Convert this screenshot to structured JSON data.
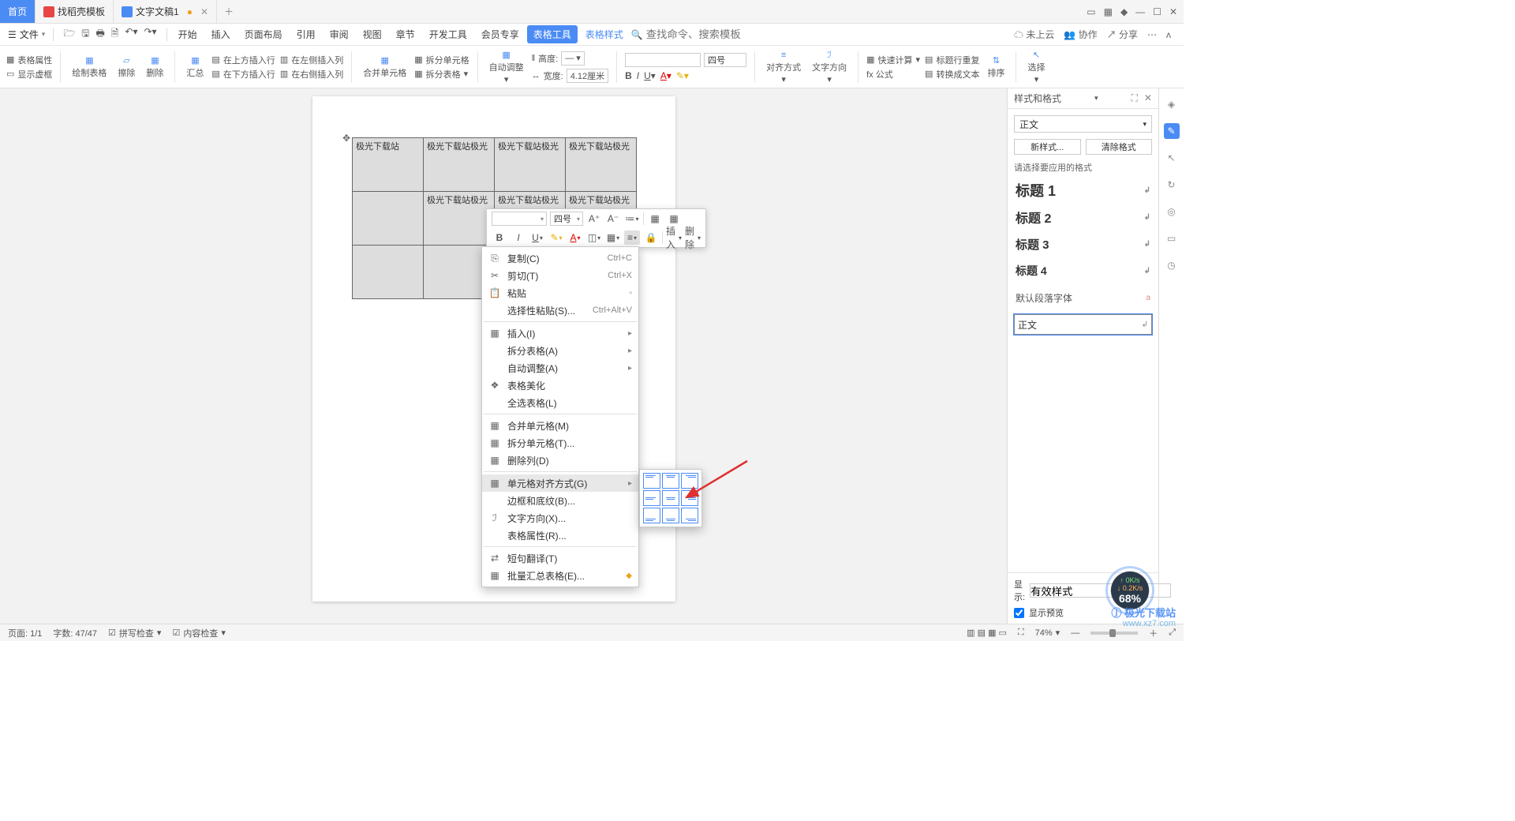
{
  "titlebar": {
    "tabs": [
      {
        "label": "首页",
        "type": "home"
      },
      {
        "label": "找稻壳模板"
      },
      {
        "label": "文字文稿1",
        "modified": true
      }
    ],
    "window_icons": [
      "▭",
      "▦",
      "◆",
      "—",
      "☐",
      "✕"
    ]
  },
  "menubar": {
    "file": "文件",
    "items": [
      "开始",
      "插入",
      "页面布局",
      "引用",
      "审阅",
      "视图",
      "章节",
      "开发工具",
      "会员专享",
      "表格工具",
      "表格样式"
    ],
    "active": "表格工具",
    "search_placeholder": "查找命令、搜索模板",
    "right": {
      "cloud": "未上云",
      "coop": "协作",
      "share": "分享"
    }
  },
  "ribbon": {
    "table_prop": "表格属性",
    "show_frame": "显示虚框",
    "draw": "绘制表格",
    "erase": "擦除",
    "delete": "删除",
    "insert_above": "在上方插入行",
    "insert_below": "在下方插入行",
    "insert_left": "在左侧插入列",
    "insert_right": "在右侧插入列",
    "sum": "汇总",
    "merge": "合并单元格",
    "split_cell": "拆分单元格",
    "split_table": "拆分表格",
    "auto_fit": "自动调整",
    "height": "高度:",
    "width": "宽度:",
    "width_val": "4.12厘米",
    "font_size": "四号",
    "align": "对齐方式",
    "text_dir": "文字方向",
    "formula": "fx 公式",
    "quick_calc": "快速计算",
    "header_repeat": "标题行重复",
    "convert": "转换成文本",
    "sort": "排序",
    "select": "选择"
  },
  "mini": {
    "font": "",
    "size": "四号",
    "ins": "插入",
    "del": "删除"
  },
  "ctx": {
    "copy": "复制(C)",
    "copy_k": "Ctrl+C",
    "cut": "剪切(T)",
    "cut_k": "Ctrl+X",
    "paste": "粘贴",
    "paste_special": "选择性粘贴(S)...",
    "paste_special_k": "Ctrl+Alt+V",
    "insert": "插入(I)",
    "split_table": "拆分表格(A)",
    "auto_fit": "自动调整(A)",
    "beautify": "表格美化",
    "select_all": "全选表格(L)",
    "merge": "合并单元格(M)",
    "split_cell": "拆分单元格(T)...",
    "del_col": "删除列(D)",
    "cell_align": "单元格对齐方式(G)",
    "border": "边框和底纹(B)...",
    "text_dir": "文字方向(X)...",
    "table_prop": "表格属性(R)...",
    "short_trans": "短句翻译(T)",
    "batch_sum": "批量汇总表格(E)..."
  },
  "table": {
    "r0": [
      "极光下载站",
      "极光下载站极光",
      "极光下载站极光",
      "极光下载站极光"
    ],
    "r1": [
      "",
      "极光下载站极光",
      "极光下载站极光",
      "极光下载站极光"
    ],
    "r2": [
      "",
      "",
      "",
      ""
    ]
  },
  "side": {
    "title": "样式和格式",
    "current": "正文",
    "new": "新样式...",
    "clear": "清除格式",
    "apply_hint": "请选择要应用的格式",
    "styles": {
      "h1": "标题 1",
      "h2": "标题 2",
      "h3": "标题 3",
      "h4": "标题 4",
      "dft": "默认段落字体",
      "body": "正文"
    },
    "show": "显示:",
    "show_val": "有效样式",
    "preview": "显示预览"
  },
  "status": {
    "page": "页面: 1/1",
    "words": "字数: 47/47",
    "spell": "拼写检查",
    "content": "内容检查",
    "zoom": "74%"
  },
  "gauge": {
    "up": "0K/s",
    "down": "0.2K/s",
    "pct": "68%"
  },
  "watermark": {
    "name": "极光下载站",
    "url": "www.xz7.com"
  }
}
